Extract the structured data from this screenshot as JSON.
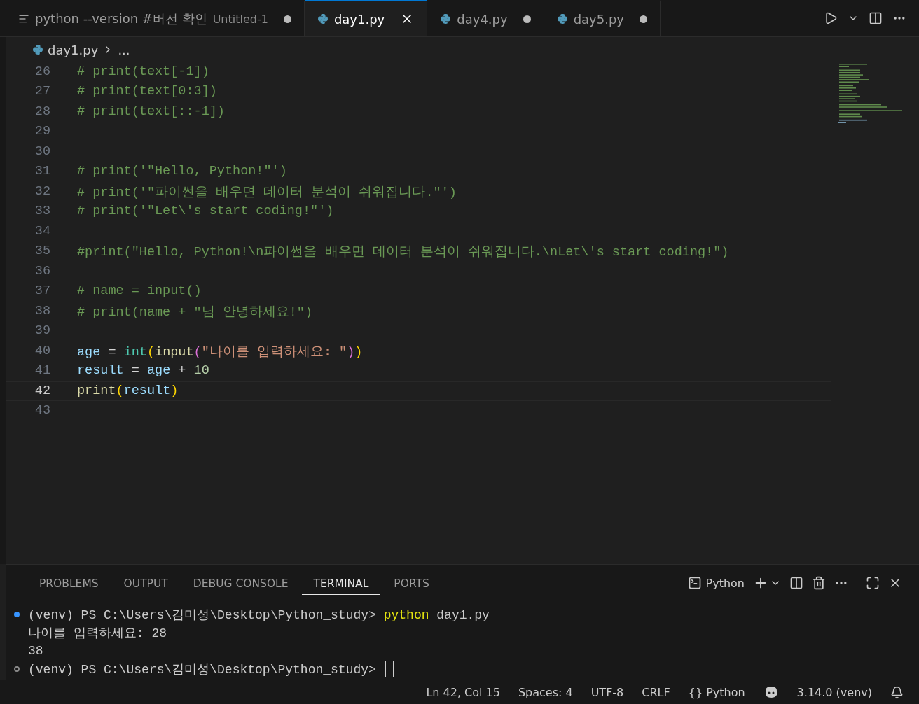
{
  "tabs": [
    {
      "label": "python --version #버전 확인",
      "detail": "Untitled-1",
      "kind": "text",
      "selected": false,
      "dirty": true
    },
    {
      "label": "day1.py",
      "kind": "python",
      "selected": true,
      "dirty": false
    },
    {
      "label": "day4.py",
      "kind": "python",
      "selected": false,
      "dirty": true
    },
    {
      "label": "day5.py",
      "kind": "python",
      "selected": false,
      "dirty": true
    }
  ],
  "breadcrumb": {
    "file": "day1.py",
    "rest": "..."
  },
  "editor": {
    "lines": [
      {
        "number": "26",
        "current": false,
        "tokens": [
          {
            "kind": "comment",
            "text": "# print(text[-1])"
          }
        ]
      },
      {
        "number": "27",
        "current": false,
        "tokens": [
          {
            "kind": "comment",
            "text": "# print(text[0:3])"
          }
        ]
      },
      {
        "number": "28",
        "current": false,
        "tokens": [
          {
            "kind": "comment",
            "text": "# print(text[::-1])"
          }
        ]
      },
      {
        "number": "29",
        "current": false
      },
      {
        "number": "30",
        "current": false
      },
      {
        "number": "31",
        "current": false,
        "tokens": [
          {
            "kind": "comment",
            "text": "# print('\"Hello, Python!\"')"
          }
        ]
      },
      {
        "number": "32",
        "current": false,
        "tokens": [
          {
            "kind": "comment",
            "text": "# print('\"파이썬을 배우면 데이터 분석이 쉬워집니다.\"')"
          }
        ]
      },
      {
        "number": "33",
        "current": false,
        "tokens": [
          {
            "kind": "comment",
            "text": "# print('\"Let\\'s start coding!\"')"
          }
        ]
      },
      {
        "number": "34",
        "current": false
      },
      {
        "number": "35",
        "current": false,
        "tokens": [
          {
            "kind": "comment",
            "text": "#print(\"Hello, Python!\\n파이썬을 배우면 데이터 분석이 쉬워집니다.\\nLet\\'s start coding!\")"
          }
        ]
      },
      {
        "number": "36",
        "current": false
      },
      {
        "number": "37",
        "current": false,
        "tokens": [
          {
            "kind": "comment",
            "text": "# name = input()"
          }
        ]
      },
      {
        "number": "38",
        "current": false,
        "tokens": [
          {
            "kind": "comment",
            "text": "# print(name + \"님 안녕하세요!\")"
          }
        ]
      },
      {
        "number": "39",
        "current": false
      },
      {
        "number": "40",
        "current": false,
        "tokens": [
          {
            "kind": "variable",
            "text": "age"
          },
          {
            "kind": "plain",
            "text": " = "
          },
          {
            "kind": "builtin",
            "text": "int"
          },
          {
            "kind": "bracket1",
            "text": "("
          },
          {
            "kind": "function",
            "text": "input"
          },
          {
            "kind": "bracket2",
            "text": "("
          },
          {
            "kind": "string",
            "text": "\"나이를 입력하세요: \""
          },
          {
            "kind": "bracket2",
            "text": ")"
          },
          {
            "kind": "bracket1",
            "text": ")"
          }
        ]
      },
      {
        "number": "41",
        "current": false,
        "tokens": [
          {
            "kind": "variable",
            "text": "result"
          },
          {
            "kind": "plain",
            "text": " = "
          },
          {
            "kind": "variable",
            "text": "age"
          },
          {
            "kind": "plain",
            "text": " + "
          },
          {
            "kind": "number",
            "text": "10"
          }
        ]
      },
      {
        "number": "42",
        "current": true,
        "tokens": [
          {
            "kind": "function",
            "text": "print"
          },
          {
            "kind": "bracket1",
            "text": "("
          },
          {
            "kind": "variable",
            "text": "result"
          },
          {
            "kind": "bracket1",
            "text": ")"
          }
        ]
      },
      {
        "number": "43",
        "current": false
      }
    ]
  },
  "panel": {
    "tabs": [
      {
        "label": "PROBLEMS",
        "selected": false
      },
      {
        "label": "OUTPUT",
        "selected": false
      },
      {
        "label": "DEBUG CONSOLE",
        "selected": false
      },
      {
        "label": "TERMINAL",
        "selected": true
      },
      {
        "label": "PORTS",
        "selected": false
      }
    ],
    "shell": "Python",
    "terminal": [
      {
        "kind": "done",
        "segments": [
          {
            "kind": "plain",
            "text": "(venv) PS C:\\Users\\김미성\\Desktop\\Python_study> "
          },
          {
            "kind": "command",
            "text": "python"
          },
          {
            "kind": "plain",
            "text": " day1.py"
          }
        ]
      },
      {
        "kind": "output",
        "segments": [
          {
            "kind": "plain",
            "text": "나이를 입력하세요: 28"
          }
        ]
      },
      {
        "kind": "output",
        "segments": [
          {
            "kind": "plain",
            "text": "38"
          }
        ]
      },
      {
        "kind": "pending",
        "cursor": true,
        "segments": [
          {
            "kind": "plain",
            "text": "(venv) PS C:\\Users\\김미성\\Desktop\\Python_study> "
          }
        ]
      }
    ]
  },
  "status_bar": {
    "items": [
      {
        "kind": "text",
        "text": "Ln 42, Col 15"
      },
      {
        "kind": "text",
        "text": "Spaces: 4"
      },
      {
        "kind": "text",
        "text": "UTF-8"
      },
      {
        "kind": "text",
        "text": "CRLF"
      },
      {
        "kind": "language",
        "icon": "{}",
        "text": "Python"
      },
      {
        "kind": "copilot"
      },
      {
        "kind": "text",
        "text": "3.14.0 (venv)"
      },
      {
        "kind": "bell"
      }
    ]
  }
}
